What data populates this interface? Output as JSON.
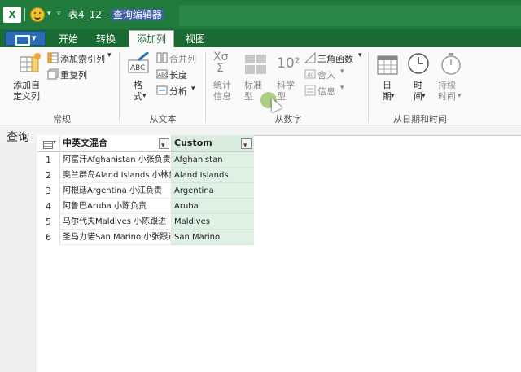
{
  "titlebar": {
    "app_icon": "X",
    "title_prefix": "表4_12 - ",
    "title_highlight": "查询编辑器"
  },
  "tabs": [
    {
      "label": "开始"
    },
    {
      "label": "转换"
    },
    {
      "label": "添加列",
      "active": true
    },
    {
      "label": "视图"
    }
  ],
  "ribbon": {
    "general": {
      "group": "常规",
      "add_custom_column": "添加自\n定义列",
      "add_index_column": "添加索引列",
      "duplicate_column": "重复列"
    },
    "from_text": {
      "group": "从文本",
      "format": "格\n式",
      "merge_columns": "合并列",
      "length": "长度",
      "parse": "分析"
    },
    "from_number": {
      "group": "从数字",
      "statistics": "统计\n信息",
      "standard": "标准\n型",
      "scientific": "科学\n型",
      "trig": "三角函数",
      "rounding": "舍入",
      "information": "信息",
      "icon_10_squared": "10²"
    },
    "from_datetime": {
      "group": "从日期和时间",
      "date": "日\n期",
      "time": "时\n间",
      "duration": "持续\n时间"
    }
  },
  "query_label": "查询",
  "table": {
    "col1": "中英文混合",
    "col2": "Custom",
    "rows": [
      {
        "num": "1",
        "c1": "阿富汗Afghanistan 小张负责",
        "c2": "Afghanistan"
      },
      {
        "num": "2",
        "c1": "奥兰群岛Aland Islands 小林负",
        "c2": "Aland Islands"
      },
      {
        "num": "3",
        "c1": "阿根廷Argentina 小江负责",
        "c2": "Argentina"
      },
      {
        "num": "4",
        "c1": "阿鲁巴Aruba 小陈负责",
        "c2": "Aruba"
      },
      {
        "num": "5",
        "c1": "马尔代夫Maldives 小陈跟进",
        "c2": "Maldives"
      },
      {
        "num": "6",
        "c1": "圣马力诺San Marino 小张跟进",
        "c2": "San Marino"
      }
    ]
  },
  "colors": {
    "titlebar": "#1f7a3c",
    "accent_column": "#dff0e4",
    "highlight": "#3c5fa5"
  }
}
